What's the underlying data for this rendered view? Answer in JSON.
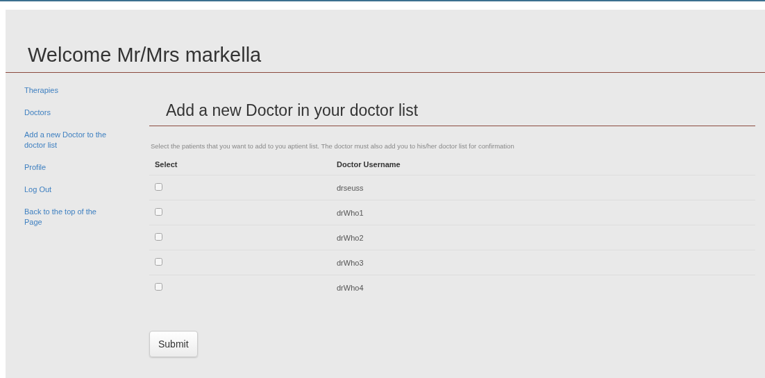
{
  "header": {
    "title": "Welcome Mr/Mrs markella"
  },
  "sidebar": {
    "items": [
      {
        "label": "Therapies"
      },
      {
        "label": "Doctors"
      },
      {
        "label": "Add a new Doctor to the doctor list"
      },
      {
        "label": "Profile"
      },
      {
        "label": "Log Out"
      },
      {
        "label": "Back to the top of the Page"
      }
    ]
  },
  "main": {
    "heading": "Add a new Doctor in your doctor list",
    "description": "Select the patients that you want to add to you aptient list. The doctor must also add you to his/her doctor list for confirmation",
    "table": {
      "columns": [
        "Select",
        "Doctor Username"
      ],
      "rows": [
        {
          "checked": false,
          "username": "drseuss"
        },
        {
          "checked": false,
          "username": "drWho1"
        },
        {
          "checked": false,
          "username": "drWho2"
        },
        {
          "checked": false,
          "username": "drWho3"
        },
        {
          "checked": false,
          "username": "drWho4"
        }
      ]
    },
    "submit": "Submit"
  }
}
